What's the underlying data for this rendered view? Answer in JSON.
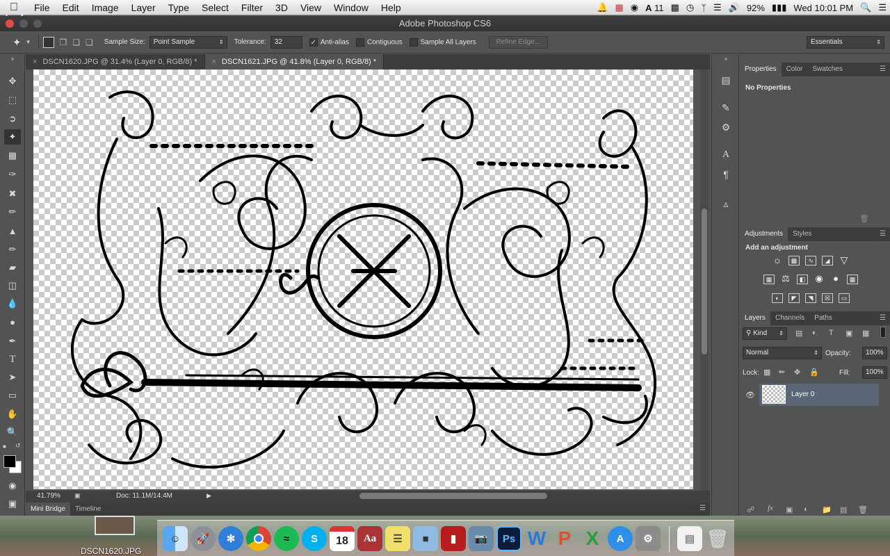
{
  "menubar": {
    "app_name": "Photoshop",
    "items": [
      "File",
      "Edit",
      "Image",
      "Layer",
      "Type",
      "Select",
      "Filter",
      "3D",
      "View",
      "Window",
      "Help"
    ],
    "status": {
      "adobe_count": "11",
      "battery": "92%",
      "clock": "Wed 10:01 PM"
    }
  },
  "window": {
    "title": "Adobe Photoshop CS6"
  },
  "options": {
    "sample_size_label": "Sample Size:",
    "sample_size_value": "Point Sample",
    "tolerance_label": "Tolerance:",
    "tolerance_value": "32",
    "anti_alias_label": "Anti-alias",
    "anti_alias_checked": true,
    "contiguous_label": "Contiguous",
    "contiguous_checked": false,
    "sample_all_layers_label": "Sample All Layers",
    "sample_all_layers_checked": false,
    "refine_edge_label": "Refine Edge...",
    "workspace_value": "Essentials"
  },
  "tabs": [
    {
      "label": "DSCN1620.JPG @ 31.4% (Layer 0, RGB/8) *",
      "active": false
    },
    {
      "label": "DSCN1621.JPG @ 41.8% (Layer 0, RGB/8) *",
      "active": true
    }
  ],
  "status": {
    "zoom": "41.79%",
    "doc_size": "Doc: 11.1M/14.4M"
  },
  "bottom_tabs": [
    "Mini Bridge",
    "Timeline"
  ],
  "panels": {
    "properties": {
      "tabs": [
        "Properties",
        "Color",
        "Swatches"
      ],
      "message": "No Properties"
    },
    "adjustments": {
      "tabs": [
        "Adjustments",
        "Styles"
      ],
      "heading": "Add an adjustment"
    },
    "layers": {
      "tabs": [
        "Layers",
        "Channels",
        "Paths"
      ],
      "filter_kind": "Kind",
      "blend_mode": "Normal",
      "opacity_label": "Opacity:",
      "opacity_value": "100%",
      "lock_label": "Lock:",
      "fill_label": "Fill:",
      "fill_value": "100%",
      "layer_name": "Layer 0"
    }
  },
  "dock": {
    "desktop_file_label": "DSCN1620.JPG",
    "calendar_day": "18"
  },
  "colors": {
    "panel_bg": "#535353",
    "tab_bg": "#3c3c3c",
    "selected_layer": "#5a6577"
  }
}
